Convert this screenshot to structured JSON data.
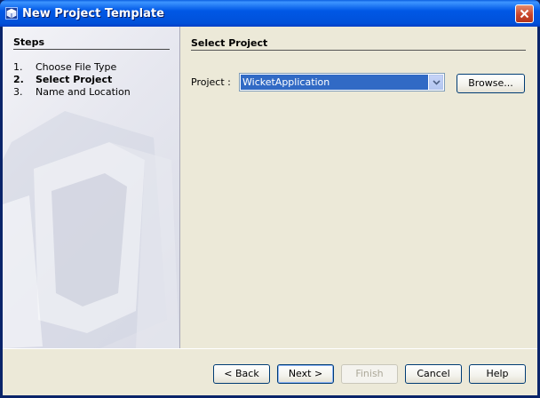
{
  "window": {
    "title": "New Project Template"
  },
  "steps": {
    "title": "Steps",
    "items": [
      {
        "num": "1.",
        "label": "Choose File Type",
        "current": false
      },
      {
        "num": "2.",
        "label": "Select Project",
        "current": true
      },
      {
        "num": "3.",
        "label": "Name and Location",
        "current": false
      }
    ]
  },
  "main": {
    "section_title": "Select Project",
    "project_label": "Project :",
    "project_value": "WicketApplication",
    "browse_label": "Browse..."
  },
  "buttons": {
    "back": "< Back",
    "next": "Next >",
    "finish": "Finish",
    "cancel": "Cancel",
    "help": "Help"
  },
  "colors": {
    "titlebar": "#0058e6",
    "selection": "#316ac5",
    "dialog_bg": "#ece9d8"
  }
}
